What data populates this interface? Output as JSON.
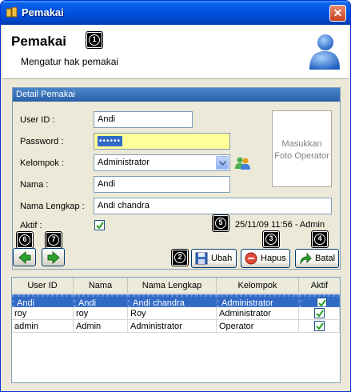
{
  "window": {
    "title": "Pemakai",
    "close_glyph": "✕"
  },
  "header": {
    "title": "Pemakai",
    "subtitle": "Mengatur hak pemakai",
    "icon": "user-icon"
  },
  "badges": [
    "1",
    "2",
    "3",
    "4",
    "5",
    "6",
    "7"
  ],
  "detail": {
    "group_title": "Detail Pemakai",
    "fields": {
      "user_id": {
        "label": "User ID :",
        "value": "Andi"
      },
      "password": {
        "label": "Password :",
        "value": "••••••"
      },
      "kelompok": {
        "label": "Kelompok :",
        "value": "Administrator"
      },
      "nama": {
        "label": "Nama :",
        "value": "Andi"
      },
      "nama_lengkap": {
        "label": "Nama Lengkap :",
        "value": "Andi chandra"
      },
      "aktif": {
        "label": "Aktif :",
        "checked": true
      }
    },
    "photo_placeholder": "Masukkan Foto Operator",
    "status": "25/11/09 11:56  -  Admin"
  },
  "toolbar": {
    "ubah_label": "Ubah",
    "hapus_label": "Hapus",
    "batal_label": "Batal"
  },
  "table": {
    "columns": [
      "User ID",
      "Nama",
      "Nama Lengkap",
      "Kelompok",
      "Aktif"
    ],
    "rows": [
      {
        "user_id": "Andi",
        "nama": "Andi",
        "nama_lengkap": "Andi chandra",
        "kelompok": "Administrator",
        "aktif": true,
        "selected": true
      },
      {
        "user_id": "roy",
        "nama": "roy",
        "nama_lengkap": "Roy",
        "kelompok": "Administrator",
        "aktif": true,
        "selected": false
      },
      {
        "user_id": "admin",
        "nama": "Admin",
        "nama_lengkap": "Administrator",
        "kelompok": "Operator",
        "aktif": true,
        "selected": false
      }
    ]
  },
  "colors": {
    "title_bar": "#0054e3",
    "selection": "#316ac5",
    "password_bg": "#ffff99",
    "group_header": "#2a5fa8"
  }
}
